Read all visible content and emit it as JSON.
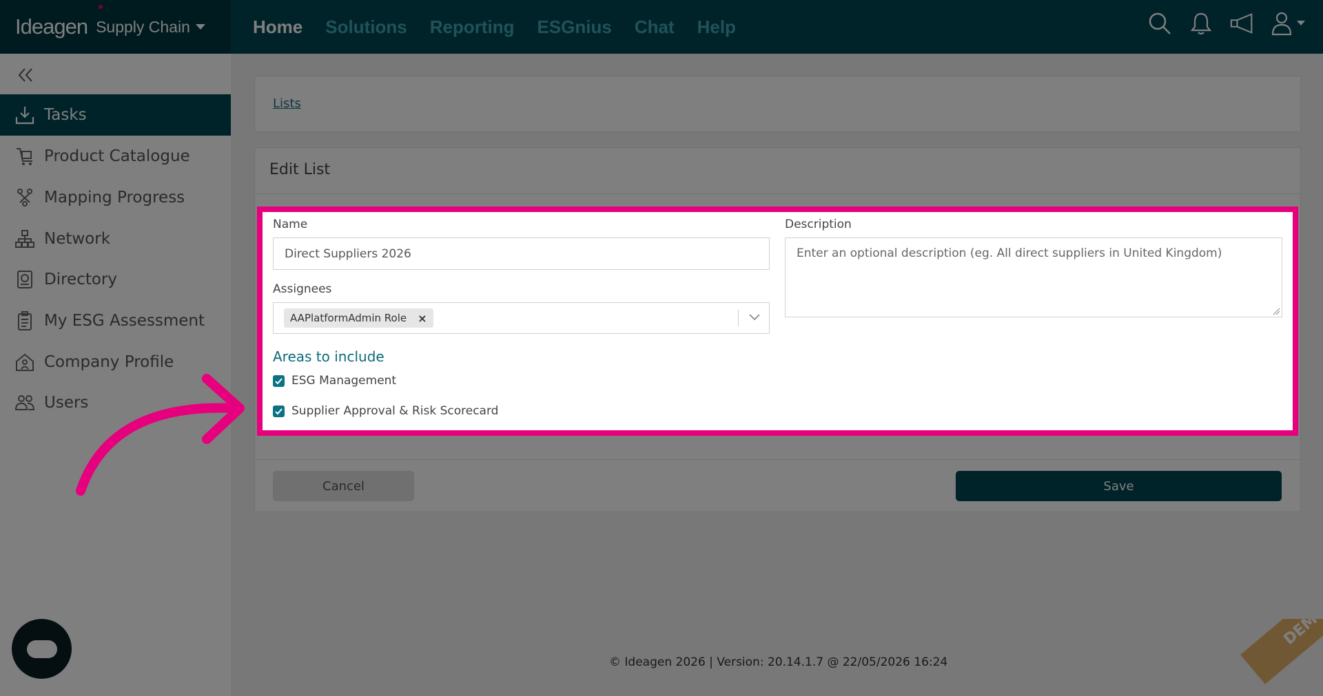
{
  "header": {
    "brand_logo": "Ideagen",
    "brand_product": "Supply Chain",
    "nav": [
      {
        "label": "Home",
        "active": true
      },
      {
        "label": "Solutions",
        "active": false
      },
      {
        "label": "Reporting",
        "active": false
      },
      {
        "label": "ESGnius",
        "active": false
      },
      {
        "label": "Chat",
        "active": false
      },
      {
        "label": "Help",
        "active": false
      }
    ],
    "icons": [
      "search-icon",
      "bell-icon",
      "megaphone-icon",
      "user-icon"
    ]
  },
  "sidebar": {
    "items": [
      {
        "label": "Tasks",
        "icon": "download-tray-icon",
        "active": true
      },
      {
        "label": "Product Catalogue",
        "icon": "trolley-icon",
        "active": false
      },
      {
        "label": "Mapping Progress",
        "icon": "progress-icon",
        "active": false
      },
      {
        "label": "Network",
        "icon": "network-icon",
        "active": false
      },
      {
        "label": "Directory",
        "icon": "directory-icon",
        "active": false
      },
      {
        "label": "My ESG Assessment",
        "icon": "clipboard-icon",
        "active": false
      },
      {
        "label": "Company Profile",
        "icon": "building-icon",
        "active": false
      },
      {
        "label": "Users",
        "icon": "users-icon",
        "active": false
      }
    ]
  },
  "breadcrumb": {
    "link": "Lists"
  },
  "form": {
    "title": "Edit List",
    "name_label": "Name",
    "name_value": "Direct Suppliers 2026",
    "description_label": "Description",
    "description_placeholder": "Enter an optional description (eg. All direct suppliers in United Kingdom)",
    "assignees_label": "Assignees",
    "assignee_tag": "AAPlatformAdmin Role",
    "tag_remove": "×",
    "areas_title": "Areas to include",
    "areas": [
      {
        "label": "ESG Management",
        "checked": true
      },
      {
        "label": "Supplier Approval & Risk Scorecard",
        "checked": true
      }
    ],
    "cancel_label": "Cancel",
    "save_label": "Save"
  },
  "footer": {
    "text": "© Ideagen 2026 | Version: 20.14.1.7 @ 22/05/2026 16:24"
  },
  "demo_badge": "DEMO",
  "colors": {
    "primary": "#014752",
    "accent": "#e6007e",
    "link": "#1a6e7c",
    "nav_inactive": "#3fa6b3"
  }
}
